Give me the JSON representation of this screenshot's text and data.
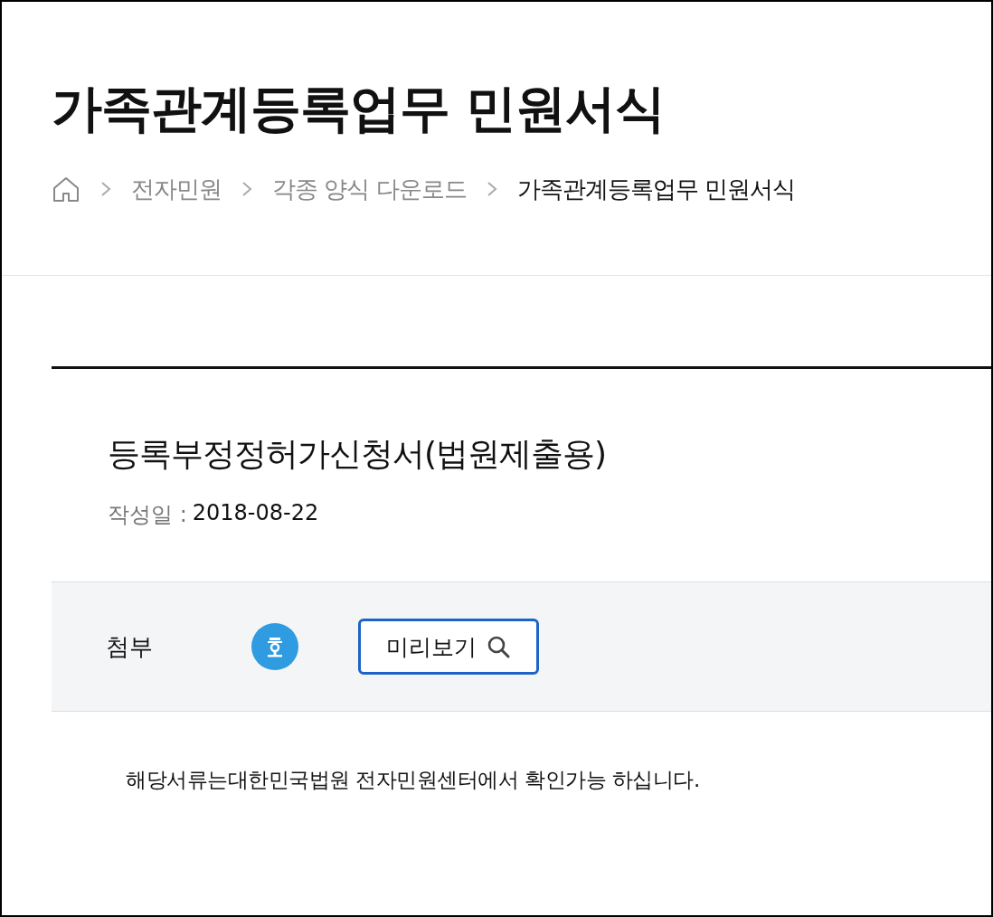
{
  "page_title": "가족관계등록업무 민원서식",
  "breadcrumbs": [
    {
      "label": "전자민원",
      "current": false
    },
    {
      "label": "각종 양식 다운로드",
      "current": false
    },
    {
      "label": "가족관계등록업무 민원서식",
      "current": true
    }
  ],
  "document": {
    "title": "등록부정정허가신청서(법원제출용)",
    "date_label": "작성일 :",
    "date": "2018-08-22"
  },
  "attachment": {
    "label": "첨부",
    "preview_button": "미리보기"
  },
  "notice": "해당서류는대한민국법원 전자민원센터에서 확인가능 하십니다."
}
